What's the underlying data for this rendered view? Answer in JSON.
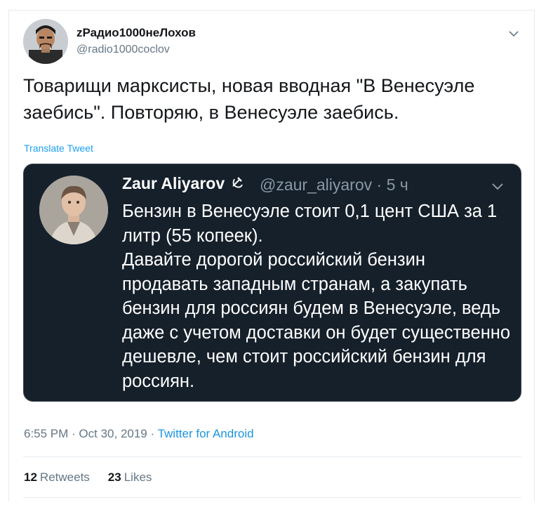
{
  "tweet": {
    "author": {
      "name": "zРадио1000неЛохов",
      "handle": "@radio1000coclov"
    },
    "text": "Товарищи марксисты, новая вводная \"В Венесуэле заебись\". Повторяю, в Венесуэле заебись.",
    "translate_label": "Translate Tweet",
    "quoted": {
      "name": "Zaur Aliyarov",
      "handle_time": "@zaur_aliyarov · 5 ч",
      "paragraph1": "Бензин в Венесуэле стоит 0,1 цент США за 1 литр (55 копеек).",
      "paragraph2": "Давайте дорогой российский бензин продавать западным странам, а закупать бензин для россиян будем в Венесуэле, ведь даже с учетом доставки он будет существенно дешевле, чем стоит российский бензин для россиян."
    },
    "timestamp": "6:55 PM · Oct 30, 2019 · ",
    "source": "Twitter for Android",
    "stats": {
      "retweets_count": "12",
      "retweets_label": "Retweets",
      "likes_count": "23",
      "likes_label": "Likes"
    }
  },
  "colors": {
    "link": "#1da1f2",
    "quote_background": "#15202b",
    "secondary_text": "#657786"
  }
}
